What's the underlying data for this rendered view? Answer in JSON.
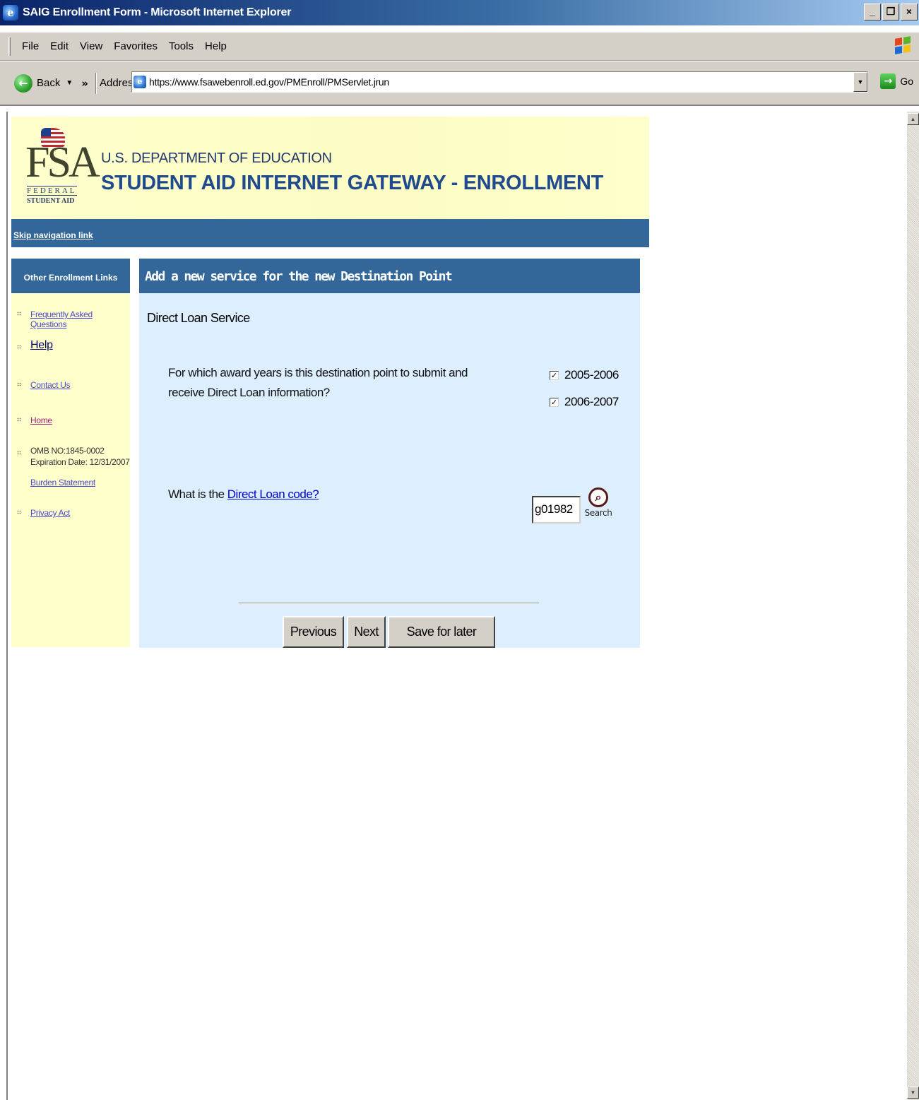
{
  "window": {
    "title": "SAIG Enrollment Form - Microsoft Internet Explorer",
    "controls": [
      "_",
      "×"
    ]
  },
  "menubar": {
    "items": [
      "File",
      "Edit",
      "View",
      "Favorites",
      "Tools",
      "Help"
    ]
  },
  "toolbar": {
    "back_label": "Back",
    "address_label": "Address",
    "url": "https://www.fsawebenroll.ed.gov/PMEnroll/PMServlet.jrun",
    "go_label": "Go"
  },
  "banner": {
    "logo_text": "FSA",
    "logo_federal": "FEDERAL",
    "logo_student_aid": "STUDENT AID",
    "department": "U.S. DEPARTMENT OF EDUCATION",
    "title": "STUDENT AID INTERNET GATEWAY - ENROLLMENT"
  },
  "nav": {
    "skip_link": "Skip navigation link"
  },
  "sidebar": {
    "heading": "Other Enrollment Links",
    "faq": "Frequently Asked Questions",
    "help": "Help",
    "contact": "Contact Us",
    "home": "Home",
    "omb": "OMB NO:1845-0002",
    "expiration": "Expiration Date: 12/31/2007",
    "burden": "Burden Statement",
    "privacy": "Privacy Act"
  },
  "form": {
    "heading": "Add a new service for the new Destination Point",
    "section_title": "Direct Loan Service",
    "question_award_years": "For which award years is this destination point to submit and receive Direct Loan information?",
    "award_years": [
      {
        "label": "2005-2006",
        "checked": true
      },
      {
        "label": "2006-2007",
        "checked": true
      }
    ],
    "question_code_prefix": "What is the ",
    "question_code_link": "Direct Loan code?",
    "code_value": "g01982",
    "search_label": "Search",
    "buttons": {
      "previous": "Previous",
      "next": "Next",
      "save": "Save for later"
    }
  }
}
